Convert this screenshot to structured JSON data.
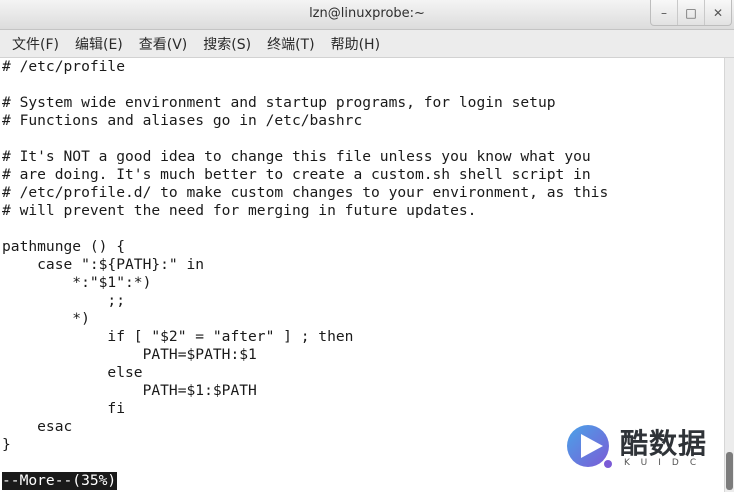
{
  "window": {
    "title": "lzn@linuxprobe:~",
    "controls": {
      "minimize": "–",
      "maximize": "□",
      "close": "✕"
    }
  },
  "menubar": {
    "items": [
      {
        "label": "文件(F)"
      },
      {
        "label": "编辑(E)"
      },
      {
        "label": "查看(V)"
      },
      {
        "label": "搜索(S)"
      },
      {
        "label": "终端(T)"
      },
      {
        "label": "帮助(H)"
      }
    ]
  },
  "terminal": {
    "lines": [
      "# /etc/profile",
      "",
      "# System wide environment and startup programs, for login setup",
      "# Functions and aliases go in /etc/bashrc",
      "",
      "# It's NOT a good idea to change this file unless you know what you",
      "# are doing. It's much better to create a custom.sh shell script in",
      "# /etc/profile.d/ to make custom changes to your environment, as this",
      "# will prevent the need for merging in future updates.",
      "",
      "pathmunge () {",
      "    case \":${PATH}:\" in",
      "        *:\"$1\":*)",
      "            ;;",
      "        *)",
      "            if [ \"$2\" = \"after\" ] ; then",
      "                PATH=$PATH:$1",
      "            else",
      "                PATH=$1:$PATH",
      "            fi",
      "    esac",
      "}"
    ],
    "status": "--More--(35%)",
    "scroll_position_percent": 35
  },
  "watermark": {
    "text": "酷数据",
    "subtext": "KUIDC",
    "colors": {
      "blue": "#4aa3e8",
      "purple": "#7b5bd6"
    }
  }
}
